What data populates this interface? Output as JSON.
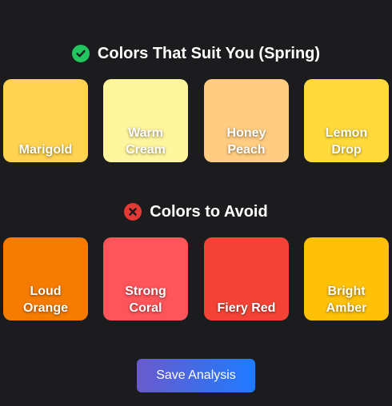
{
  "suit_section": {
    "title": "Colors That Suit You (Spring)",
    "icon": "check-circle-icon",
    "icon_color": "#22c55e",
    "swatches": [
      {
        "label": "Marigold",
        "color": "#FFD34F"
      },
      {
        "label": "Warm\nCream",
        "color": "#FFF59D"
      },
      {
        "label": "Honey\nPeach",
        "color": "#FFCC80"
      },
      {
        "label": "Lemon\nDrop",
        "color": "#FFDA3A"
      }
    ]
  },
  "avoid_section": {
    "title": "Colors to Avoid",
    "icon": "x-circle-icon",
    "icon_color": "#e53935",
    "swatches": [
      {
        "label": "Loud\nOrange",
        "color": "#F57C00"
      },
      {
        "label": "Strong\nCoral",
        "color": "#FF5459"
      },
      {
        "label": "Fiery Red",
        "color": "#F44336"
      },
      {
        "label": "Bright\nAmber",
        "color": "#FFC107"
      }
    ]
  },
  "actions": {
    "save_label": "Save Analysis"
  }
}
